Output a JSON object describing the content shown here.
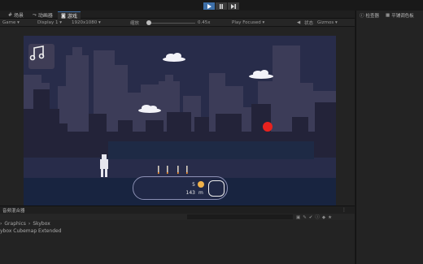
{
  "toolbar_top": {
    "play_icon": "play-icon",
    "pause_icon": "pause-icon",
    "step_icon": "step-icon"
  },
  "tabs": [
    {
      "label": "场景",
      "icon": "hash-icon"
    },
    {
      "label": "动画器",
      "icon": "animator-icon"
    },
    {
      "label": "游戏",
      "icon": "gamepad-icon"
    }
  ],
  "game_toolbar": {
    "display": "Display 1",
    "resolution": "1920x1080",
    "scale_label": "缩放",
    "scale_value": "0.45x",
    "play_focused": "Play Focused",
    "stats": "状态",
    "gizmos": "Gizmos"
  },
  "hud": {
    "coins": "5",
    "distance": "143",
    "unit": "m"
  },
  "right_tabs": [
    {
      "label": "检查器",
      "icon": "info-icon"
    },
    {
      "label": "平铺调色板",
      "icon": "palette-icon"
    }
  ],
  "bottom_panel": {
    "tab": "音频混合器",
    "breadcrumb": [
      "Graphics",
      "Skybox"
    ],
    "item": "ybox Cubemap Extended"
  },
  "colors": {
    "sky": "#282c4a",
    "buildings_far": "#3c3c58",
    "buildings_near": "#232339",
    "platform": "#1e2a45",
    "ground": "#182440",
    "enemy": "#e8221e",
    "coin": "#f0b24a",
    "accent": "#3d6fa8"
  }
}
